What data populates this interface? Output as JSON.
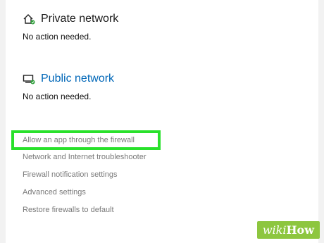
{
  "private_network": {
    "icon": "home-network-icon",
    "title": "Private network",
    "status": "No action needed."
  },
  "public_network": {
    "icon": "public-network-icon",
    "title": "Public network",
    "status": "No action needed.",
    "title_color": "#0067b8"
  },
  "links": [
    {
      "label": "Allow an app through the firewall",
      "highlighted": true,
      "highlight_color": "#29e12b"
    },
    {
      "label": "Network and Internet troubleshooter"
    },
    {
      "label": "Firewall notification settings"
    },
    {
      "label": "Advanced settings"
    },
    {
      "label": "Restore firewalls to default"
    }
  ],
  "watermark": {
    "prefix": "wiki",
    "suffix": "How",
    "color": "#8dc63f"
  }
}
